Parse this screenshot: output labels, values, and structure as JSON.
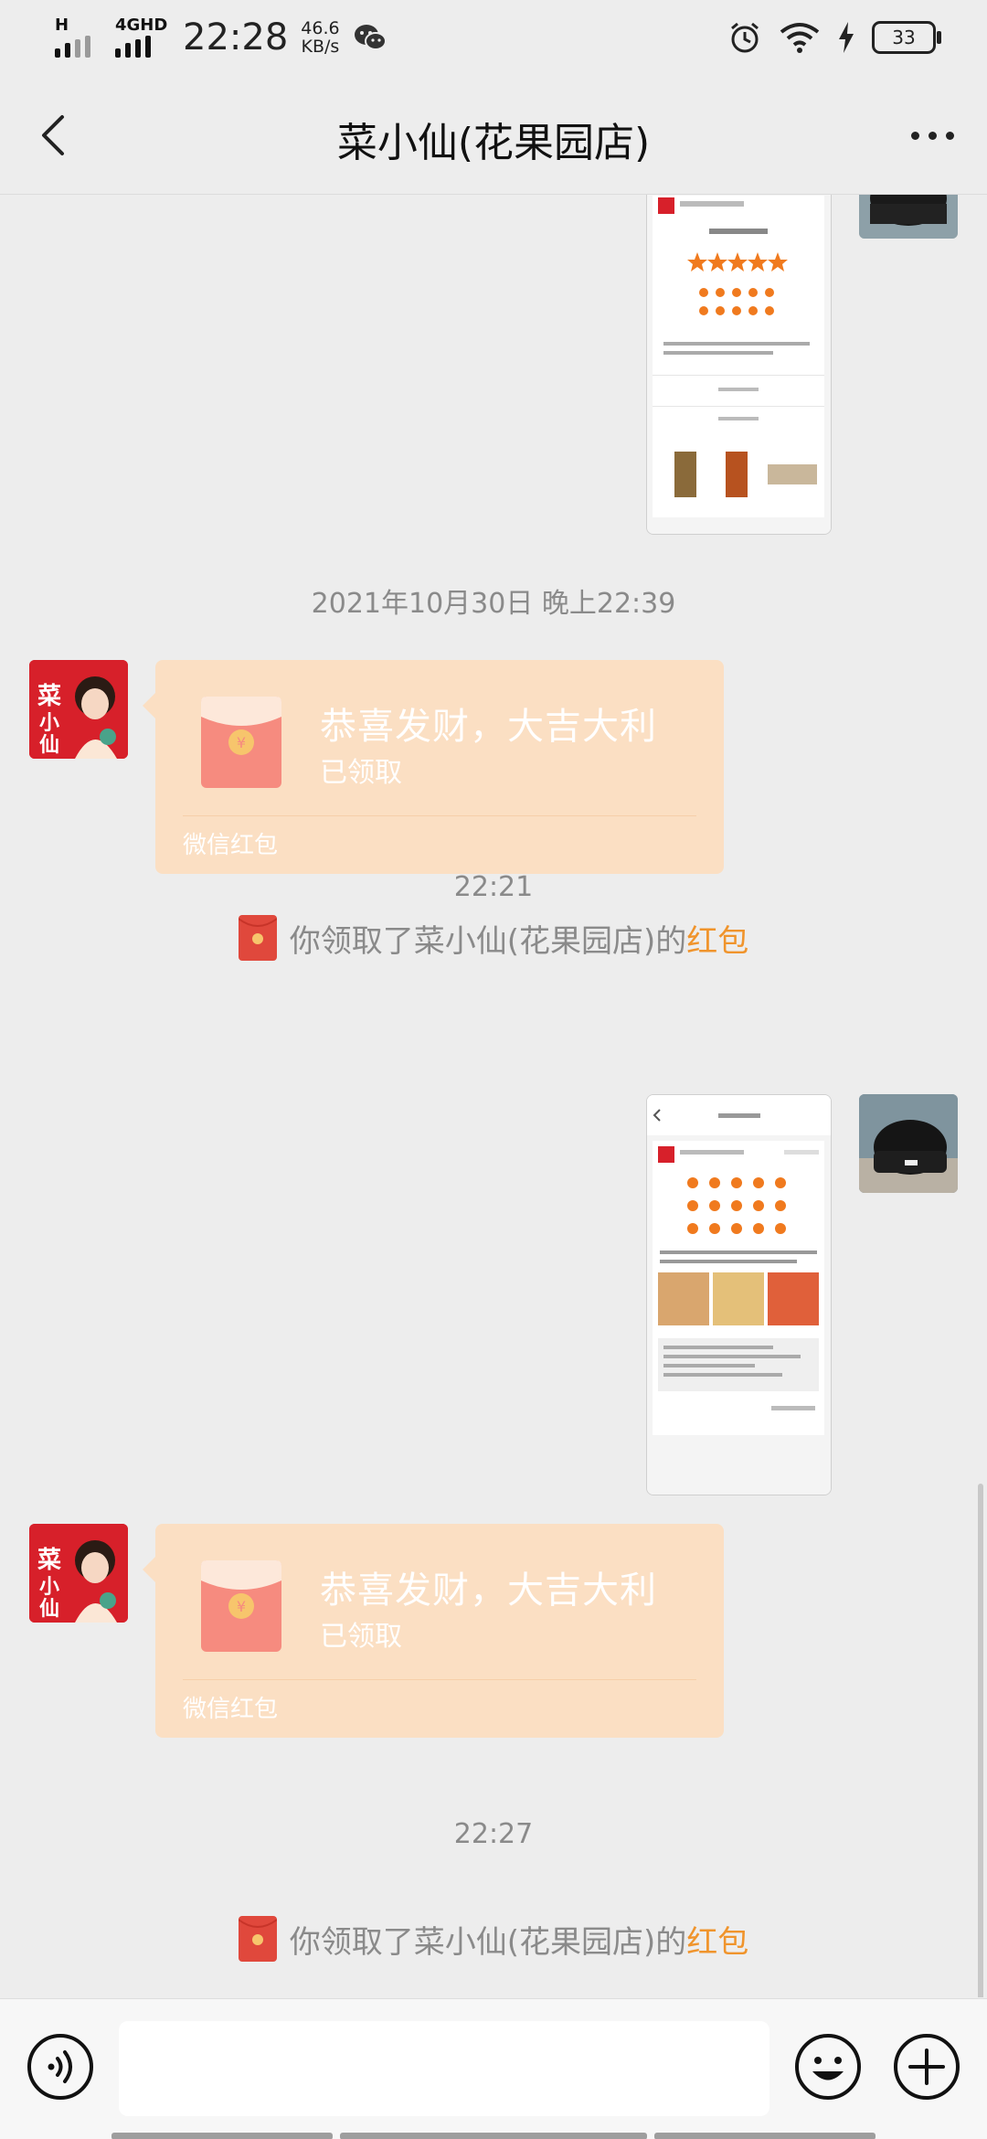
{
  "status_bar": {
    "net1": "H",
    "net2": "4GHD",
    "time": "22:28",
    "speed_value": "46.6",
    "speed_unit": "KB/s",
    "battery": "33"
  },
  "nav": {
    "title": "菜小仙(花果园店)"
  },
  "messages": {
    "timestamp_1": "2021年10月30日 晚上22:39",
    "redpacket_1": {
      "wish": "恭喜发财，大吉大利",
      "status": "已领取",
      "brand": "微信红包"
    },
    "notice_1": {
      "text": "你领取了菜小仙(花果园店)的",
      "link": "红包"
    },
    "timestamp_2": "22:21",
    "redpacket_2": {
      "wish": "恭喜发财，大吉大利",
      "status": "已领取",
      "brand": "微信红包"
    },
    "timestamp_3": "22:27",
    "notice_2": {
      "text": "你领取了菜小仙(花果园店)的",
      "link": "红包"
    }
  },
  "avatar_left": {
    "text": "菜小仙"
  },
  "colors": {
    "background": "#ededed",
    "redpacket": "#fbdfc3",
    "accent": "#f0942c",
    "star": "#f07a1e"
  }
}
